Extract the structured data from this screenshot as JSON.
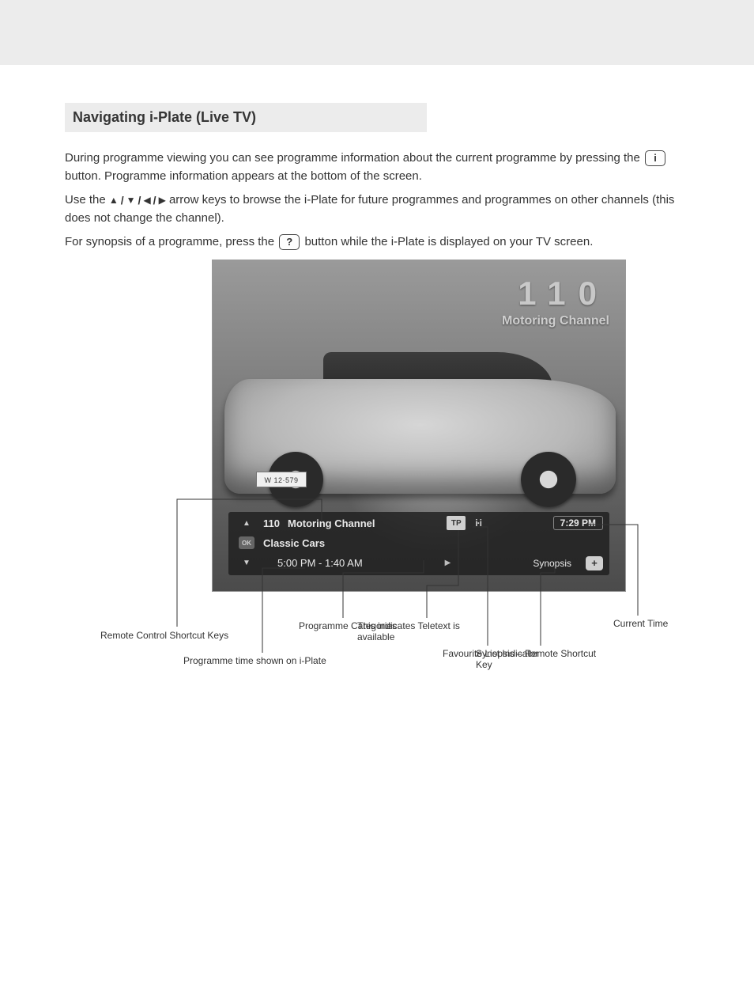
{
  "heading": "Navigating i-Plate (Live TV)",
  "p1_pre": "During programme viewing you can see programme information about the current programme by pressing the ",
  "p1_button": "i",
  "p1_post": " button. Programme information appears at the bottom of the screen.",
  "p2_pre": "Use the ",
  "p2_post": " arrow keys to browse the i-Plate for future programmes and programmes on other channels (this does not change the channel).",
  "p3_pre": "For synopsis of a programme, press the ",
  "p3_button": "?",
  "p3_post": " button while the i-Plate is displayed on your TV screen.",
  "tv": {
    "channel_number": "110",
    "channel_name": "Motoring Channel",
    "plate": "W 12·579"
  },
  "info_bar": {
    "channel_number": "110",
    "channel_name": "Motoring Channel",
    "programme_title": "Classic Cars",
    "time_range": "5:00 PM - 1:40 AM",
    "tp": "TP",
    "clock": "7:29 PM",
    "synopsis_label": "Synopsis",
    "ok_label": "OK"
  },
  "callouts": {
    "remote_shortcuts": "Remote Control Shortcut Keys",
    "time_shown": "Programme time shown on i-Plate",
    "categories": "Programme Categories",
    "teletext": "This indicates Teletext is available",
    "list_ind": "Favourite List Indicator",
    "syn_shortcut": "Synopsis – Remote Shortcut Key",
    "current_time": "Current Time"
  }
}
